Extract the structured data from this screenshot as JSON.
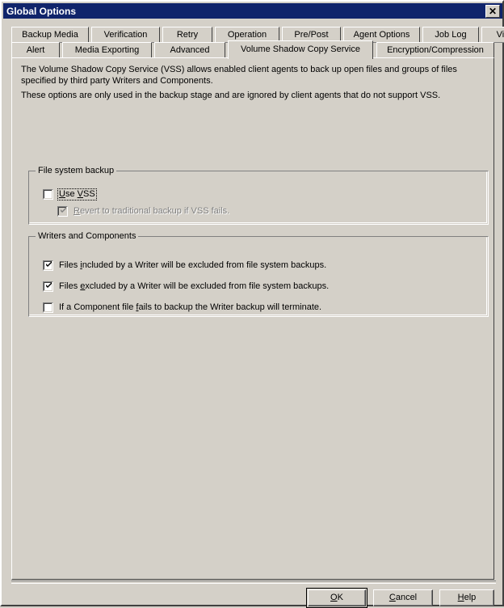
{
  "window": {
    "title": "Global Options",
    "close_glyph": "✕"
  },
  "tabs": {
    "row1": [
      {
        "label": "Backup Media",
        "active": false
      },
      {
        "label": "Verification",
        "active": false
      },
      {
        "label": "Retry",
        "active": false
      },
      {
        "label": "Operation",
        "active": false
      },
      {
        "label": "Pre/Post",
        "active": false
      },
      {
        "label": "Agent Options",
        "active": false
      },
      {
        "label": "Job Log",
        "active": false
      },
      {
        "label": "Virus",
        "active": false
      }
    ],
    "row2": [
      {
        "label": "Alert",
        "active": false
      },
      {
        "label": "Media Exporting",
        "active": false
      },
      {
        "label": "Advanced",
        "active": false
      },
      {
        "label": "Volume Shadow Copy Service",
        "active": true
      },
      {
        "label": "Encryption/Compression",
        "active": false
      }
    ]
  },
  "panel": {
    "description_1": "The Volume Shadow Copy Service (VSS) allows enabled client agents to back up open files and groups of files specified by third party Writers and Components.",
    "description_2": "These options are only used in the backup stage and are ignored by client agents that do not support VSS.",
    "groups": {
      "file_system_backup": {
        "label": "File system backup",
        "checkboxes": [
          {
            "id": "use-vss",
            "label_before": "U",
            "label_mid": "se ",
            "accel2": "V",
            "label_after": "SS",
            "full_label": "Use VSS",
            "checked": false,
            "disabled": false,
            "focused": true
          },
          {
            "id": "revert-traditional",
            "accel": "R",
            "label_after": "evert to traditional backup if VSS fails.",
            "full_label": "Revert to traditional backup if VSS fails.",
            "checked": true,
            "disabled": true,
            "focused": false
          }
        ]
      },
      "writers_and_components": {
        "label": "Writers and Components",
        "checkboxes": [
          {
            "id": "files-included",
            "label_before": "Files ",
            "accel": "i",
            "label_after": "ncluded by a Writer will be excluded from file system backups.",
            "full_label": "Files included by a Writer will be excluded from file system backups.",
            "checked": true,
            "disabled": false,
            "focused": false
          },
          {
            "id": "files-excluded",
            "label_before": "Files ",
            "accel": "e",
            "label_after": "xcluded by a Writer will be excluded from file system backups.",
            "full_label": "Files excluded by a Writer will be excluded from file system backups.",
            "checked": true,
            "disabled": false,
            "focused": false
          },
          {
            "id": "component-fails",
            "label_before": "If a Component file ",
            "accel": "f",
            "label_after": "ails to backup the Writer backup will terminate.",
            "full_label": "If a Component file fails to backup the Writer backup will terminate.",
            "checked": false,
            "disabled": false,
            "focused": false
          }
        ]
      }
    }
  },
  "buttons": {
    "ok": {
      "accel": "O",
      "rest": "K",
      "full_label": "OK",
      "default": true
    },
    "cancel": {
      "accel": "C",
      "rest": "ancel",
      "full_label": "Cancel",
      "default": false
    },
    "help": {
      "accel": "H",
      "rest": "elp",
      "full_label": "Help",
      "default": false
    }
  },
  "colors": {
    "titlebar": "#10246b",
    "face": "#d4d0c8",
    "shadow": "#808080",
    "dark_shadow": "#404040",
    "highlight": "#ffffff",
    "text": "#000000",
    "disabled_text": "#808080"
  }
}
